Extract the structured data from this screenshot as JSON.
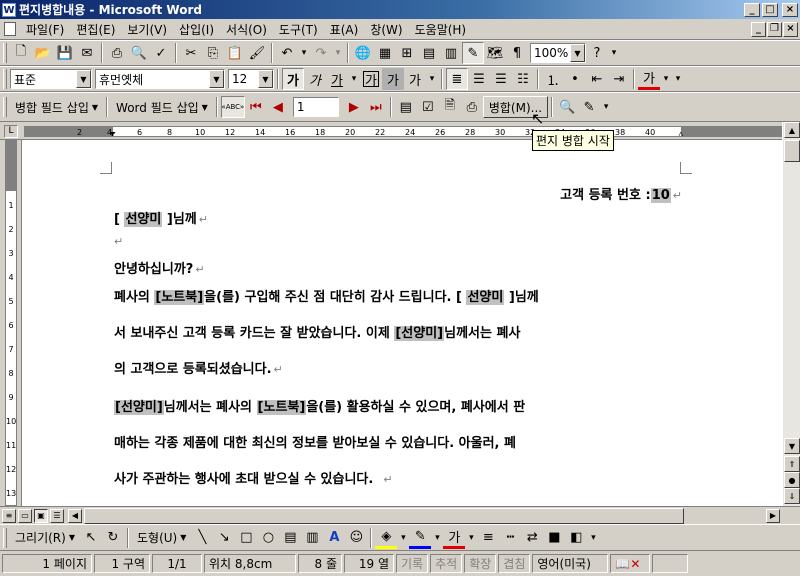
{
  "window": {
    "app_icon": "W",
    "title": "편지병합내용 - Microsoft Word",
    "minimize": "_",
    "maximize": "□",
    "close": "×"
  },
  "menu": {
    "items": [
      "파일(F)",
      "편집(E)",
      "보기(V)",
      "삽입(I)",
      "서식(O)",
      "도구(T)",
      "표(A)",
      "창(W)",
      "도움말(H)"
    ],
    "doc_minimize": "_",
    "doc_restore": "❐",
    "doc_close": "×"
  },
  "standard_toolbar": {
    "zoom": "100%",
    "icons": [
      "new-document-icon",
      "open-icon",
      "save-icon",
      "email-icon",
      "print-icon",
      "print-preview-icon",
      "spelling-icon",
      "cut-icon",
      "copy-icon",
      "paste-icon",
      "format-painter-icon",
      "undo-icon",
      "redo-icon",
      "hyperlink-icon",
      "tables-borders-icon",
      "insert-table-icon",
      "insert-excel-icon",
      "columns-icon",
      "drawing-icon",
      "document-map-icon",
      "show-hide-icon",
      "help-icon"
    ]
  },
  "formatting_toolbar": {
    "style": "표준",
    "font": "휴먼옛체",
    "size": "12",
    "bold": "가",
    "italic": "가",
    "underline": "가",
    "char_border": "가",
    "char_shading": "가",
    "char_scale": "가",
    "font_color": "가"
  },
  "mailmerge_toolbar": {
    "insert_merge_field": "병합 필드 삽입",
    "insert_word_field": "Word 필드 삽입",
    "view_merged_data": "«ABC»",
    "record_number": "1",
    "merge_button": "병합(M)...",
    "tooltip": "편지 병합 시작"
  },
  "ruler": {
    "tab_selector": "L",
    "numbers": [
      "2",
      "4",
      "6",
      "8",
      "10",
      "12",
      "14",
      "16",
      "18",
      "20",
      "22",
      "24",
      "26",
      "28",
      "30",
      "32",
      "34",
      "36",
      "38",
      "40"
    ],
    "vertical_numbers": [
      "1",
      "2",
      "3",
      "4",
      "5",
      "6",
      "7",
      "8",
      "9",
      "10",
      "11",
      "12",
      "13"
    ]
  },
  "document": {
    "line1_prefix": "고객 등록 번호 :",
    "line1_field": "10",
    "line2_open": "[ ",
    "line2_field": "선양미",
    "line2_close": " ]님께",
    "greeting": "안녕하십니까?",
    "p1_a": "폐사의 ",
    "p1_field_product": "[노트북]",
    "p1_b": "을(를) 구입해 주신 점 대단히 감사 드립니다. [ ",
    "p1_field_name": "선양미",
    "p1_c": " ]님께",
    "p1_line2_a": "서 보내주신 고객 등록 카드는 잘 받았습니다.  이제 ",
    "p1_line2_field": "[선양미]",
    "p1_line2_b": "님께서는 폐사",
    "p1_line3": "의 고객으로 등록되셨습니다.",
    "p2_field_name": "[선양미]",
    "p2_a": "님께서는 폐사의 ",
    "p2_field_product": "[노트북]",
    "p2_b": "을(를)  활용하실 수 있으며,  폐사에서 판",
    "p2_line2": "매하는 각종 제품에 대한 최신의 정보를 받아보실 수 있습니다.  아울러, 폐",
    "p2_line3": "사가 주관하는 행사에 초대 받으실 수 있습니다.",
    "para_mark": "↵"
  },
  "drawing_toolbar": {
    "draw": "그리기(R)",
    "autoshapes": "도형(U)"
  },
  "status": {
    "page": "1 페이지",
    "section": "1 구역",
    "page_of": "1/1",
    "position": "위치 8,8cm",
    "line": "8 줄",
    "column": "19 열",
    "rec": "기록",
    "trk": "추적",
    "ext": "확장",
    "ovr": "겹침",
    "language": "영어(미국)"
  }
}
